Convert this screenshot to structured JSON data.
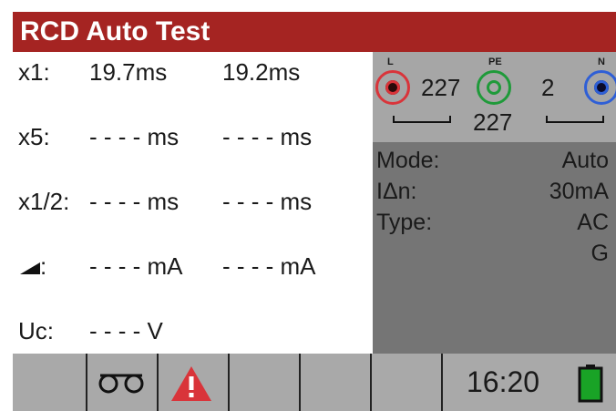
{
  "title": "RCD Auto Test",
  "results": [
    {
      "label": "x1:",
      "value1": "19.7ms",
      "value2": "19.2ms"
    },
    {
      "label": "x5:",
      "value1": "- - - - ms",
      "value2": "- - - - ms"
    },
    {
      "label": "x1/2:",
      "value1": "- - - - ms",
      "value2": "- - - - ms"
    },
    {
      "label": ":",
      "value1": "- - - - mA",
      "value2": "- - - - mA",
      "icon": "ramp-icon"
    },
    {
      "label": "Uc:",
      "value1": "- - - - V"
    }
  ],
  "terminals": {
    "l": {
      "tag": "L",
      "color": "#d9343a"
    },
    "pe": {
      "tag": "PE",
      "color": "#1f9a3a"
    },
    "n": {
      "tag": "N",
      "color": "#2f5fd6"
    },
    "voltage_l_pe": "227",
    "voltage_pe_n": "2",
    "voltage_l_n": "227"
  },
  "settings": [
    {
      "key": "Mode:",
      "value": "Auto"
    },
    {
      "key": "IΔn:",
      "value": "30mA"
    },
    {
      "key": "Type:",
      "value": "AC"
    },
    {
      "key": "",
      "value": "G"
    }
  ],
  "status_bar": {
    "icons": [
      "tape-icon",
      "warning-icon",
      "battery-icon"
    ],
    "time": "16:20",
    "battery_color": "#19a326",
    "warning_color": "#d9343a"
  },
  "colors": {
    "title_bar": "#a52422",
    "left_panel": "#ffffff",
    "right_panel": "#757575",
    "probe_area": "#a6a6a6",
    "bottom_bar": "#a9a9a9"
  }
}
